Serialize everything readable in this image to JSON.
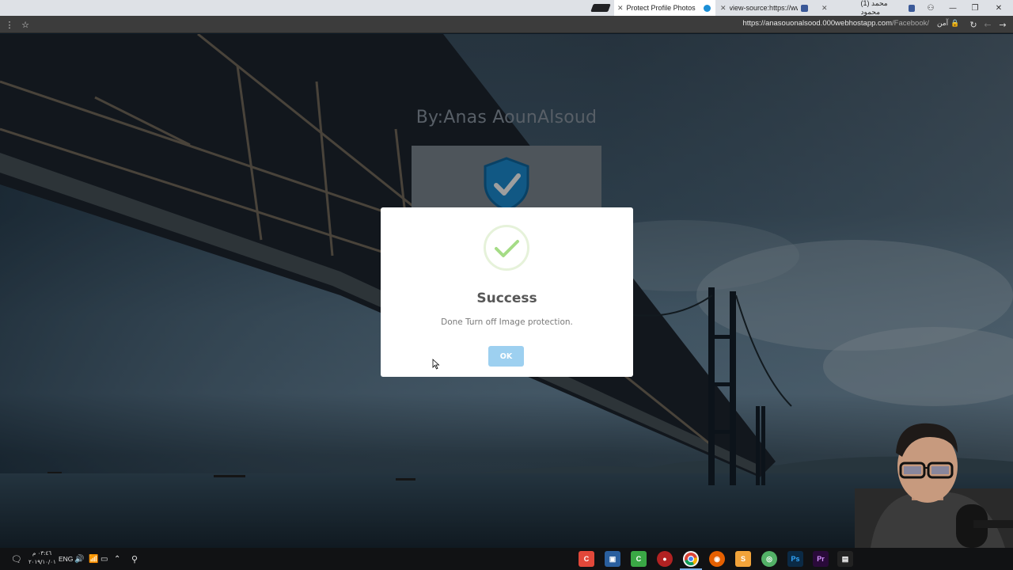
{
  "browser": {
    "tabs": [
      {
        "title": "Protect Profile Photos",
        "active": true
      },
      {
        "title": "view-source:https://www",
        "active": false
      },
      {
        "title": "(1) محمد محمود",
        "active": false
      }
    ],
    "address": {
      "host": "https://anasouonalsood.000webhostapp.com",
      "path": "/Facebook/",
      "secure_label": "آمن"
    },
    "icons": [
      "menu-icon",
      "star-icon",
      "lock-icon",
      "reload-icon",
      "back-icon",
      "forward-icon",
      "close-icon",
      "minimize-icon",
      "restore-icon",
      "incognito-icon"
    ]
  },
  "page": {
    "title": "By:Anas AounAlsoud",
    "brand_color": "#1c8fd6"
  },
  "dialog": {
    "title": "Success",
    "message": "Done Turn off Image protection.",
    "ok_label": "OK",
    "accent": "#a5dc86",
    "button_color": "#9dd0f0"
  },
  "taskbar": {
    "language": "ENG",
    "time": "٠٣:٤٦ م",
    "date": "٢٠١٩/١٠/٠١",
    "apps": [
      "camtasia",
      "video-editor",
      "camtasia-recorder",
      "recorder",
      "chrome",
      "firefox",
      "sublime-text",
      "browser",
      "photoshop",
      "premiere",
      "app"
    ]
  }
}
